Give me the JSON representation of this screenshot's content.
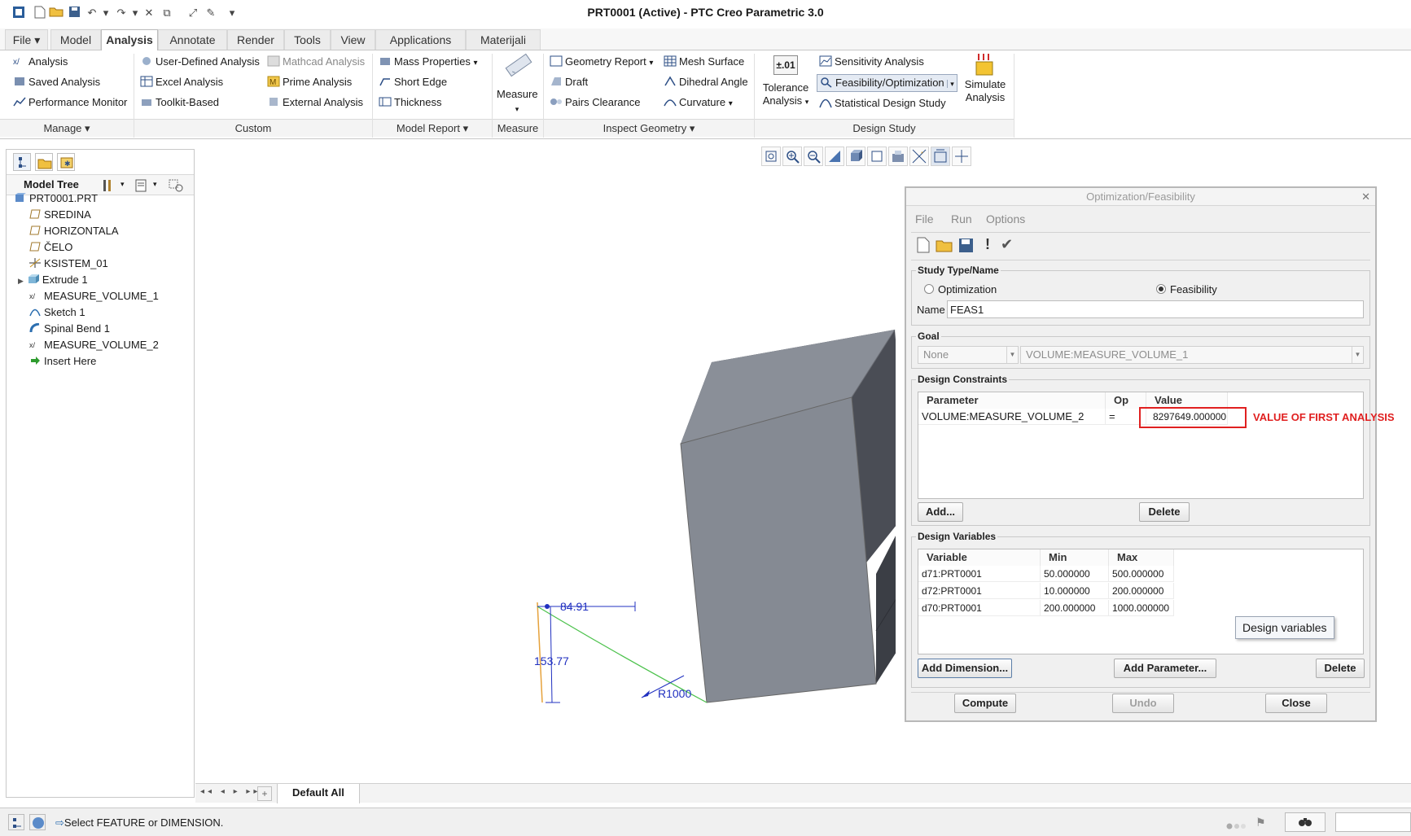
{
  "window": {
    "title": "PRT0001 (Active) - PTC Creo Parametric 3.0"
  },
  "tabs": [
    "File",
    "Model",
    "Analysis",
    "Annotate",
    "Render",
    "Tools",
    "View",
    "Applications",
    "Materijali"
  ],
  "ribbon": {
    "manage": {
      "items": [
        "Analysis",
        "Saved Analysis",
        "Performance Monitor"
      ],
      "group": "Manage"
    },
    "custom": {
      "items": [
        "User-Defined Analysis",
        "Excel Analysis",
        "Toolkit-Based",
        "Mathcad Analysis",
        "Prime Analysis",
        "External Analysis"
      ],
      "group": "Custom"
    },
    "model_report": {
      "items": [
        "Mass Properties",
        "Short Edge",
        "Thickness"
      ],
      "group": "Model Report"
    },
    "measure": {
      "label": "Measure",
      "group": "Measure"
    },
    "inspect": {
      "items": [
        "Geometry Report",
        "Draft",
        "Pairs Clearance",
        "Mesh Surface",
        "Dihedral Angle",
        "Curvature"
      ],
      "group": "Inspect Geometry"
    },
    "design_study": {
      "tolerance": "Tolerance Analysis",
      "tolerance_icon": "±.01",
      "items": [
        "Sensitivity Analysis",
        "Feasibility/Optimization",
        "Statistical Design Study"
      ],
      "simulate": "Simulate Analysis",
      "group": "Design Study"
    }
  },
  "model_tree": {
    "title": "Model Tree",
    "items": [
      "PRT0001.PRT",
      "SREDINA",
      "HORIZONTALA",
      "ČELO",
      "KSISTEM_01",
      "Extrude 1",
      "MEASURE_VOLUME_1",
      "Sketch 1",
      "Spinal Bend 1",
      "MEASURE_VOLUME_2",
      "Insert Here"
    ]
  },
  "viewport": {
    "dims": [
      "84.91",
      "153.77",
      "R1000"
    ],
    "view_tab": "Default All"
  },
  "status": {
    "message": "Select FEATURE or DIMENSION."
  },
  "dialog": {
    "title": "Optimization/Feasibility",
    "menus": [
      "File",
      "Run",
      "Options"
    ],
    "study": {
      "label": "Study Type/Name",
      "options": [
        "Optimization",
        "Feasibility"
      ],
      "selected": "Feasibility",
      "name_label": "Name",
      "name_value": "FEAS1"
    },
    "goal": {
      "label": "Goal",
      "type": "None",
      "param": "VOLUME:MEASURE_VOLUME_1"
    },
    "constraints": {
      "label": "Design Constraints",
      "headers": [
        "Parameter",
        "Op",
        "Value"
      ],
      "rows": [
        {
          "param": "VOLUME:MEASURE_VOLUME_2",
          "op": "=",
          "value": "8297649.000000"
        }
      ],
      "add": "Add...",
      "delete": "Delete"
    },
    "annotation": "VALUE OF FIRST ANALYSIS",
    "annotation_color": "#e02020",
    "variables": {
      "label": "Design Variables",
      "headers": [
        "Variable",
        "Min",
        "Max"
      ],
      "rows": [
        {
          "var": "d71:PRT0001",
          "min": "50.000000",
          "max": "500.000000"
        },
        {
          "var": "d72:PRT0001",
          "min": "10.000000",
          "max": "200.000000"
        },
        {
          "var": "d70:PRT0001",
          "min": "200.000000",
          "max": "1000.000000"
        }
      ],
      "tooltip": "Design variables",
      "add_dimension": "Add Dimension...",
      "add_parameter": "Add Parameter...",
      "delete": "Delete"
    },
    "buttons": {
      "compute": "Compute",
      "undo": "Undo",
      "close": "Close"
    }
  }
}
